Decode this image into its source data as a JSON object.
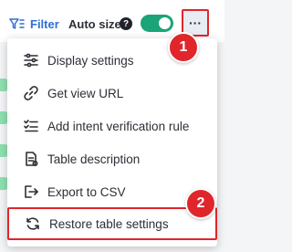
{
  "toolbar": {
    "filter_label": "Filter",
    "autosize_label": "Auto size",
    "help_glyph": "?",
    "autosize_enabled": true,
    "more_glyph": "···"
  },
  "menu": {
    "items": [
      {
        "label": "Display settings",
        "icon": "sliders-icon"
      },
      {
        "label": "Get view URL",
        "icon": "link-icon"
      },
      {
        "label": "Add intent verification rule",
        "icon": "checklist-icon"
      },
      {
        "label": "Table description",
        "icon": "document-icon"
      },
      {
        "label": "Export to CSV",
        "icon": "export-icon"
      },
      {
        "label": "Restore table settings",
        "icon": "refresh-icon"
      }
    ]
  },
  "callouts": [
    {
      "number": "1"
    },
    {
      "number": "2"
    }
  ],
  "colors": {
    "accent": "#2f6fd6",
    "toggle_on": "#1aa477",
    "highlight": "#e0262b"
  }
}
